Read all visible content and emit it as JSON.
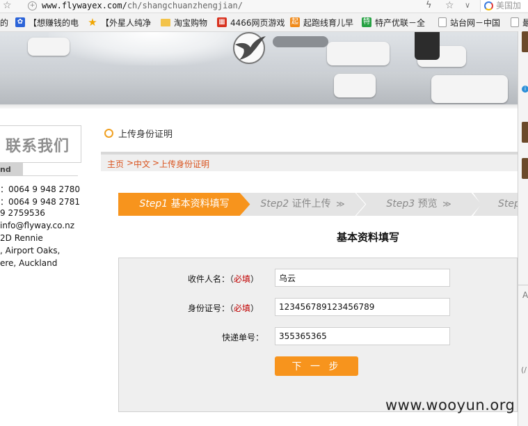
{
  "browser": {
    "url_domain": "www.flyway",
    "url_tld": "ex.com/",
    "url_path": "ch/shangchuanzhengjian/",
    "search_text": "美国加",
    "bookmarks": [
      {
        "label": "的",
        "icon": "text-icon"
      },
      {
        "label": "【想赚钱的电",
        "icon": "paw-icon"
      },
      {
        "label": "【外星人纯净",
        "icon": "star-icon"
      },
      {
        "label": "淘宝购物",
        "icon": "folder-icon"
      },
      {
        "label": "4466网页游戏",
        "icon": "game-icon"
      },
      {
        "label": "起跑线育儿早",
        "icon": "qi-icon"
      },
      {
        "label": "特产优联－全",
        "icon": "te-icon"
      },
      {
        "label": "站台网－中国",
        "icon": "page-icon"
      },
      {
        "label": "最",
        "icon": "page-icon"
      }
    ],
    "side_panel": {
      "letter": "A",
      "bottom": "(/"
    }
  },
  "contact": {
    "title": "联系我们",
    "region": "nd",
    "lines": [
      "：0064 9 948 2780",
      "：0064 9 948 2781",
      "9 2759536",
      "info@flyway.co.nz",
      "2D Rennie",
      ", Airport Oaks,",
      "ere, Auckland"
    ]
  },
  "page": {
    "section_title": "上传身份证明",
    "breadcrumb": {
      "home": "主页",
      "separator": ">",
      "lang": "中文",
      "current": "上传身份证明"
    },
    "steps": [
      {
        "num": "Step1",
        "label": "基本资料填写",
        "arrow": ""
      },
      {
        "num": "Step2",
        "label": "证件上传",
        "arrow": "≫"
      },
      {
        "num": "Step3",
        "label": "预览",
        "arrow": "≫"
      },
      {
        "num": "Step",
        "label": "",
        "arrow": ""
      }
    ],
    "form_heading": "基本资料填写"
  },
  "form": {
    "recipient": {
      "label": "收件人名：（",
      "required": "必填",
      "close": "）",
      "value": "乌云"
    },
    "id_number": {
      "label": "身份证号：（",
      "required": "必填",
      "close": "）",
      "value": "123456789123456789"
    },
    "tracking": {
      "label": "快递单号：",
      "value": "355365365"
    },
    "next_button": "下 一 步"
  },
  "watermark": "www.wooyun.org",
  "colors": {
    "accent": "#f7941d",
    "crumb": "#d9531e",
    "required": "#c00000"
  }
}
